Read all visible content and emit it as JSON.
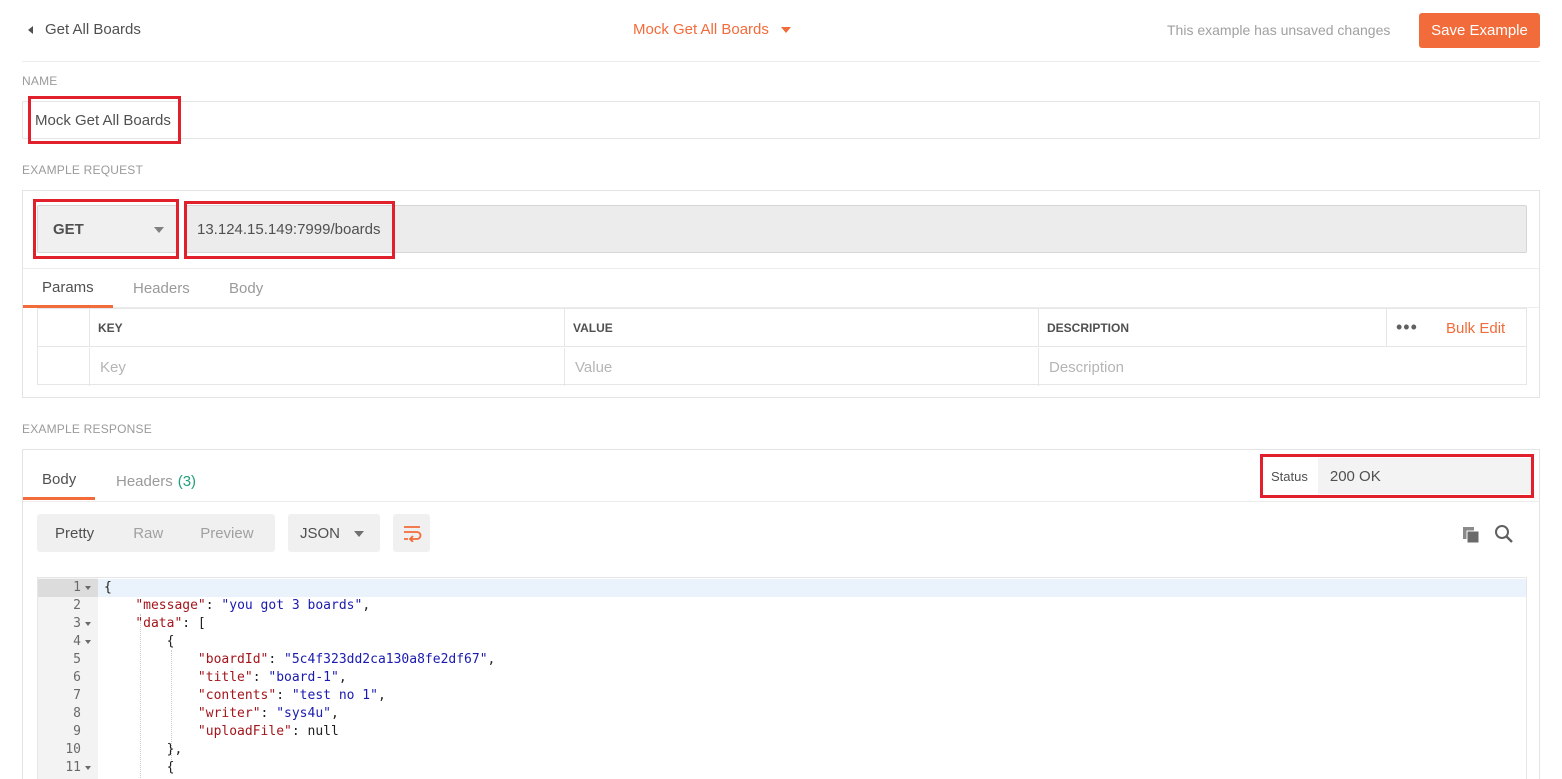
{
  "header": {
    "back_label": "Get All Boards",
    "example_title": "Mock Get All Boards",
    "unsaved_text": "This example has unsaved changes",
    "save_label": "Save Example"
  },
  "name_section": {
    "label": "NAME",
    "value": "Mock Get All Boards"
  },
  "request": {
    "label": "EXAMPLE REQUEST",
    "method": "GET",
    "url": "13.124.15.149:7999/boards",
    "tabs": [
      "Params",
      "Headers",
      "Body"
    ],
    "active_tab": "Params",
    "params_table": {
      "headers": [
        "KEY",
        "VALUE",
        "DESCRIPTION"
      ],
      "placeholders": [
        "Key",
        "Value",
        "Description"
      ],
      "more": "•••",
      "bulk_edit": "Bulk Edit"
    }
  },
  "response": {
    "label": "EXAMPLE RESPONSE",
    "tabs": {
      "body": "Body",
      "headers": "Headers",
      "headers_count": "(3)"
    },
    "status_label": "Status",
    "status_value": "200 OK",
    "formats": [
      "Pretty",
      "Raw",
      "Preview"
    ],
    "active_format": "Pretty",
    "language": "JSON",
    "code_lines": [
      {
        "n": "1",
        "fold": true
      },
      {
        "n": "2"
      },
      {
        "n": "3",
        "fold": true
      },
      {
        "n": "4",
        "fold": true
      },
      {
        "n": "5"
      },
      {
        "n": "6"
      },
      {
        "n": "7"
      },
      {
        "n": "8"
      },
      {
        "n": "9"
      },
      {
        "n": "10"
      },
      {
        "n": "11",
        "fold": true
      }
    ],
    "json": {
      "message_key": "\"message\"",
      "message_val": "\"you got 3 boards\"",
      "data_key": "\"data\"",
      "boardId_key": "\"boardId\"",
      "boardId_val": "\"5c4f323dd2ca130a8fe2df67\"",
      "title_key": "\"title\"",
      "title_val": "\"board-1\"",
      "contents_key": "\"contents\"",
      "contents_val": "\"test no 1\"",
      "writer_key": "\"writer\"",
      "writer_val": "\"sys4u\"",
      "uploadFile_key": "\"uploadFile\"",
      "uploadFile_val": "null"
    }
  },
  "colors": {
    "accent": "#f26b3a",
    "highlight": "#e0212b",
    "count": "#20a07a"
  }
}
